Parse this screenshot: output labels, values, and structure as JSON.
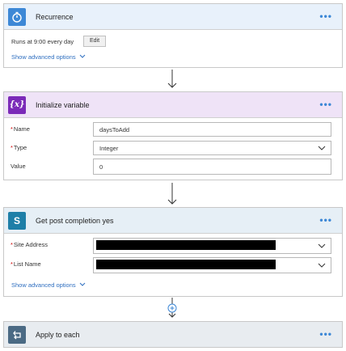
{
  "recurrence": {
    "title": "Recurrence",
    "icon": "timer-icon",
    "color": "#3d88d6",
    "summary": "Runs at 9:00 every day",
    "edit_label": "Edit",
    "advanced_label": "Show advanced options"
  },
  "init_variable": {
    "title": "Initialize variable",
    "icon": "variable-icon",
    "color": "#7b2ab8",
    "icon_text": "{x}",
    "fields": {
      "name": {
        "label": "Name",
        "value": "daysToAdd"
      },
      "type": {
        "label": "Type",
        "value": "Integer"
      },
      "value": {
        "label": "Value",
        "value": "0"
      }
    }
  },
  "get_post": {
    "title": "Get post completion yes",
    "icon": "sharepoint-icon",
    "color": "#1e7fa8",
    "icon_text": "S",
    "fields": {
      "site": {
        "label": "Site Address"
      },
      "list": {
        "label": "List Name"
      }
    },
    "advanced_label": "Show advanced options"
  },
  "apply_each": {
    "title": "Apply to each",
    "icon": "loop-icon",
    "color": "#4b6a84"
  },
  "more_label": "•••"
}
